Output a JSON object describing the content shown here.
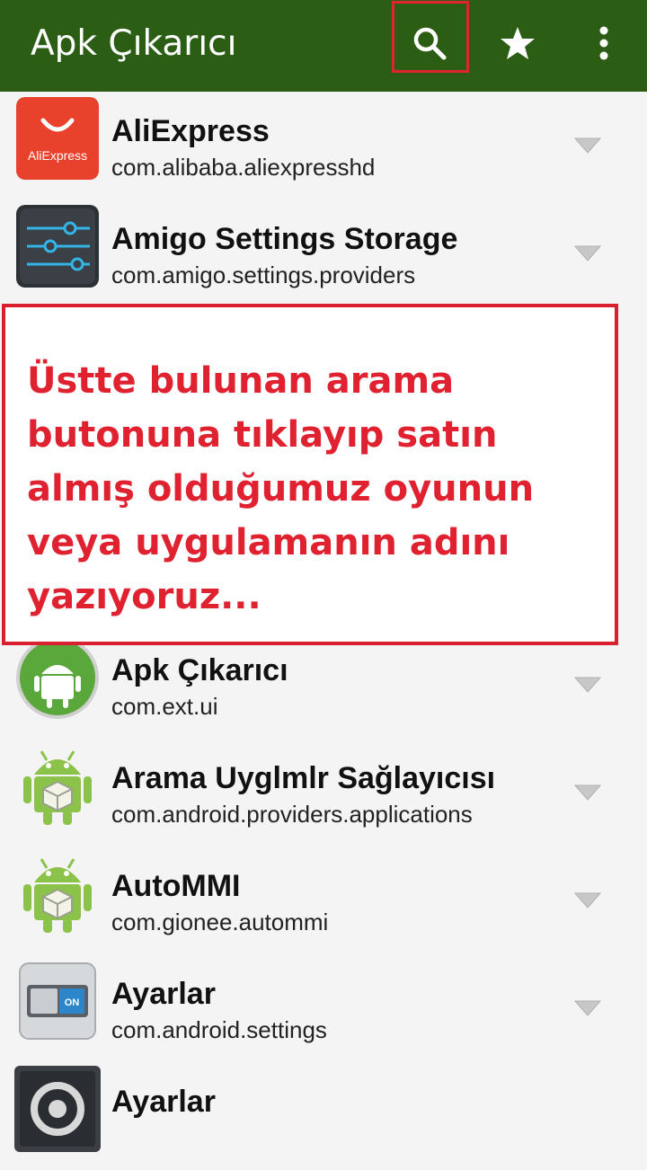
{
  "app_bar": {
    "title": "Apk Çıkarıcı",
    "background": "#2b5e14",
    "actions": [
      "search-icon",
      "star-icon",
      "overflow-menu-icon"
    ]
  },
  "apps": [
    {
      "name": "AliExpress",
      "package": "com.alibaba.aliexpresshd",
      "icon": "aliexpress-icon",
      "icon_text": "AliExpress"
    },
    {
      "name": "Amigo Settings Storage",
      "package": "com.amigo.settings.providers",
      "icon": "settings-sliders-icon"
    },
    {
      "name": "Apk Çıkarıcı",
      "package": "com.ext.ui",
      "icon": "android-circle-icon"
    },
    {
      "name": "Arama Uyglmlr Sağlayıcısı",
      "package": "com.android.providers.applications",
      "icon": "android-package-icon"
    },
    {
      "name": "AutoMMI",
      "package": "com.gionee.autommi",
      "icon": "android-package-icon"
    },
    {
      "name": "Ayarlar",
      "package": "com.android.settings",
      "icon": "settings-toggle-icon",
      "icon_text": "ON"
    },
    {
      "name": "Ayarlar",
      "package": "",
      "icon": "gear-icon"
    }
  ],
  "callout": {
    "text": "Üstte bulunan arama butonuna tıklayıp satın almış olduğumuz oyunun veya uygulamanın adını yazıyoruz...",
    "color": "#e02130"
  }
}
